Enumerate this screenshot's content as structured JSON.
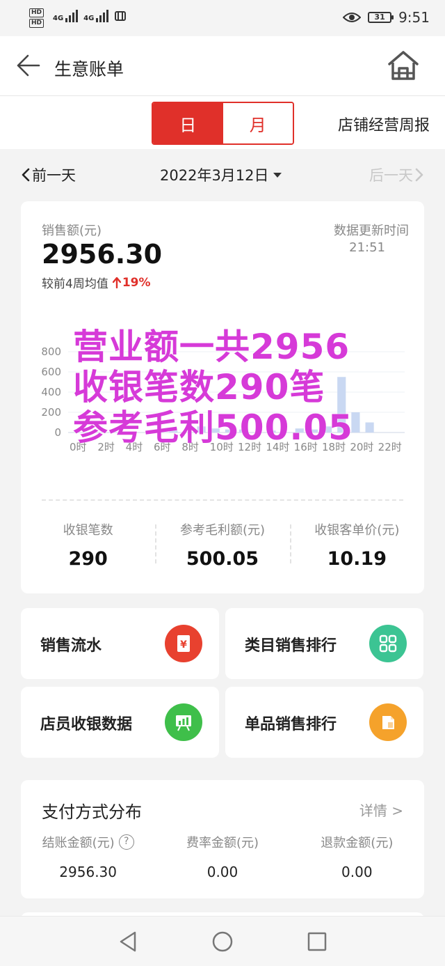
{
  "status_bar": {
    "hd1": "HD",
    "hd2": "HD",
    "net1": "4G",
    "net2": "4G",
    "battery": "31",
    "time": "9:51"
  },
  "navbar": {
    "title": "生意账单"
  },
  "tabs": {
    "day": "日",
    "month": "月",
    "weekly_report": "店铺经营周报"
  },
  "date_nav": {
    "prev": "前一天",
    "date": "2022年3月12日",
    "next": "后一天"
  },
  "summary": {
    "sales_label": "销售额(元)",
    "sales_value": "2956.30",
    "compare_label": "较前4周均值",
    "compare_pct": "19%",
    "update_label": "数据更新时间",
    "update_time": "21:51"
  },
  "chart_data": {
    "type": "bar",
    "y_ticks": [
      "800",
      "600",
      "400",
      "200",
      "0"
    ],
    "ylim": [
      0,
      800
    ],
    "x_ticks": [
      "0时",
      "2时",
      "4时",
      "6时",
      "8时",
      "10时",
      "12时",
      "14时",
      "16时",
      "18时",
      "20时",
      "22时"
    ],
    "hours": [
      7,
      9,
      10,
      11,
      12,
      14,
      16,
      17,
      18,
      19,
      20,
      21
    ],
    "values": [
      20,
      60,
      40,
      30,
      30,
      20,
      40,
      30,
      60,
      550,
      200,
      100
    ],
    "grid": true,
    "bar_color": "#c9d8f2"
  },
  "overlay": {
    "line1": "营业额一共2956",
    "line2": "收银笔数290笔",
    "line3": "参考毛利500.05",
    "color": "#d63ad8"
  },
  "stats": [
    {
      "label": "收银笔数",
      "value": "290"
    },
    {
      "label": "参考毛利额(元)",
      "value": "500.05"
    },
    {
      "label": "收银客单价(元)",
      "value": "10.19"
    }
  ],
  "tiles": {
    "sales_flow": {
      "label": "销售流水",
      "icon_glyph": "¥",
      "color": "#e8412f"
    },
    "category_rank": {
      "label": "类目销售排行",
      "color": "#3cc493"
    },
    "staff_data": {
      "label": "店员收银数据",
      "color": "#3fbf4a"
    },
    "item_rank": {
      "label": "单品销售排行",
      "color": "#f5a22b"
    }
  },
  "payment": {
    "title": "支付方式分布",
    "more": "详情 >",
    "help": "?",
    "cols": [
      {
        "label": "结账金额(元)",
        "value": "2956.30"
      },
      {
        "label": "费率金额(元)",
        "value": "0.00"
      },
      {
        "label": "退款金额(元)",
        "value": "0.00"
      }
    ]
  },
  "accent_color": "#e0302a"
}
